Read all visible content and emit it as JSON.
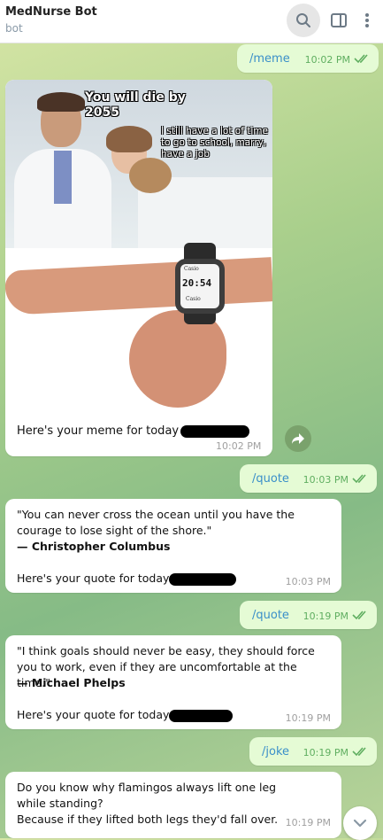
{
  "chat": {
    "title": "MedNurse Bot",
    "subtitle": "bot"
  },
  "meme": {
    "command": "/meme",
    "command_time": "10:02 PM",
    "top_caption": "You will die by 2055",
    "girl_caption": "I still have a lot of time to go to school, marry, have a job",
    "watch_time": "20:54",
    "watch_top_label": "Casio",
    "watch_bottom_label": "Casio",
    "caption": "Here's your meme for today",
    "time": "10:02 PM"
  },
  "quote1": {
    "command": "/quote",
    "command_time": "10:03 PM",
    "text": "\"You can never cross the ocean until you have the courage to lose sight of the shore.\"",
    "author": "— Christopher Columbus",
    "footer": "Here's your quote for today",
    "time": "10:03 PM"
  },
  "quote2": {
    "command": "/quote",
    "command_time": "10:19 PM",
    "text": "\"I think goals should never be easy, they should force you to work, even if they are uncomfortable at the time.\"",
    "author": "— Michael Phelps",
    "footer": "Here's your quote for today",
    "time": "10:19 PM"
  },
  "joke": {
    "command": "/joke",
    "command_time": "10:19 PM",
    "line1": "Do you know why flamingos always lift one leg while standing?",
    "line2": "Because if they lifted both legs they'd fall over.",
    "time": "10:19 PM"
  },
  "colors": {
    "outgoing_bubble": "#e5fbd5",
    "link": "#3a8fc9",
    "read_check": "#5fae60"
  },
  "icons": [
    "search-icon",
    "sidebar-toggle-icon",
    "more-vertical-icon",
    "double-check-icon",
    "forward-icon",
    "chevron-down-icon"
  ]
}
